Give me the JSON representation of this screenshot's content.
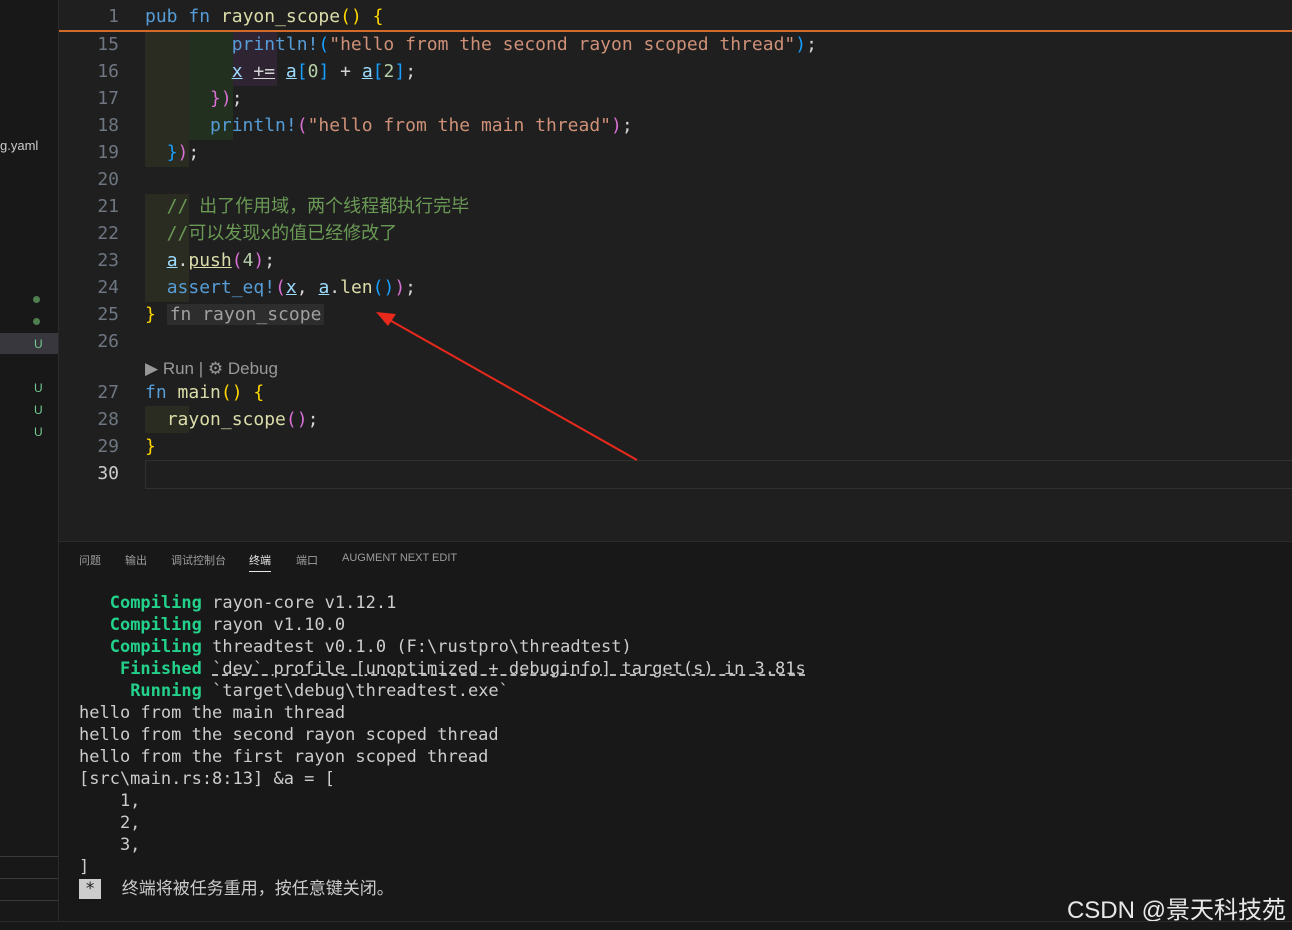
{
  "sidebar": {
    "file_label": "g.yaml",
    "badges": [
      "U",
      "U",
      "U",
      "U"
    ]
  },
  "editor": {
    "sticky": {
      "ln": "1"
    },
    "lines": [
      {
        "ln": "15"
      },
      {
        "ln": "16"
      },
      {
        "ln": "17"
      },
      {
        "ln": "18"
      },
      {
        "ln": "19"
      },
      {
        "ln": "20"
      },
      {
        "ln": "21"
      },
      {
        "ln": "22"
      },
      {
        "ln": "23"
      },
      {
        "ln": "24"
      },
      {
        "ln": "25"
      },
      {
        "ln": "26"
      },
      {
        "ln": "27"
      },
      {
        "ln": "28"
      },
      {
        "ln": "29"
      },
      {
        "ln": "30"
      }
    ],
    "inlay_hint": "fn rayon_scope",
    "codelens": {
      "run": "Run",
      "sep": "|",
      "debug": "Debug"
    }
  },
  "panel": {
    "tabs": [
      "问题",
      "输出",
      "调试控制台",
      "终端",
      "端口",
      "AUGMENT NEXT EDIT"
    ],
    "active_tab": "终端",
    "terminal": {
      "compile": [
        {
          "status": "Compiling",
          "text": "rayon-core v1.12.1"
        },
        {
          "status": "Compiling",
          "text": "rayon v1.10.0"
        },
        {
          "status": "Compiling",
          "text": "threadtest v0.1.0 (F:\\rustpro\\threadtest)"
        }
      ],
      "finished": {
        "status": "Finished",
        "text": "`dev` profile [unoptimized + debuginfo] target(s) in 3.81s"
      },
      "running": {
        "status": "Running",
        "text": "`target\\debug\\threadtest.exe`"
      },
      "output": [
        "hello from the main thread",
        "hello from the second rayon scoped thread",
        "hello from the first rayon scoped thread",
        "[src\\main.rs:8:13] &a = [",
        "    1,",
        "    2,",
        "    3,",
        "]"
      ],
      "reuse_marker": "*",
      "reuse_msg": "终端将被任务重用，按任意键关闭。"
    }
  },
  "watermark": "CSDN @景天科技苑",
  "colors": {
    "accent_green": "#23d18b",
    "arrow": "#e8291c"
  }
}
